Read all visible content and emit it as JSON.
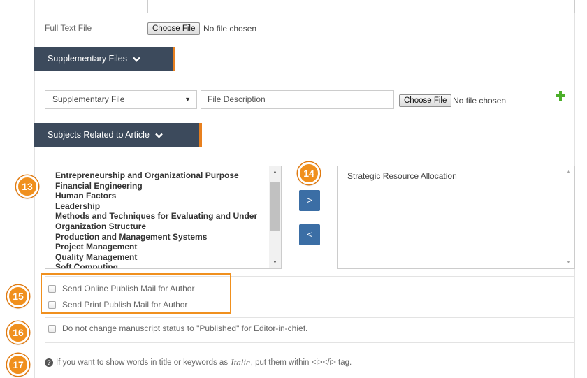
{
  "full_text": {
    "label": "Full Text File",
    "choose_label": "Choose File",
    "status": "No file chosen"
  },
  "supplementary": {
    "header": "Supplementary Files",
    "select_value": "Supplementary File",
    "description_placeholder": "File Description",
    "choose_label": "Choose File",
    "status": "No file chosen",
    "add_icon": "plus-icon"
  },
  "subjects": {
    "header": "Subjects Related to Article",
    "available": [
      "Entrepreneurship and Organizational Purpose",
      "Financial Engineering",
      "Human Factors",
      "Leadership",
      "Methods and Techniques for Evaluating and Under",
      "Organization Structure",
      "Production and Management Systems",
      "Project Management",
      "Quality Management",
      "Soft Computing"
    ],
    "selected": [
      "Strategic Resource Allocation"
    ],
    "move_right_label": ">",
    "move_left_label": "<"
  },
  "badges": {
    "b13": "13",
    "b14": "14",
    "b15": "15",
    "b16": "16",
    "b17": "17"
  },
  "publish_mail": {
    "online": "Send Online Publish Mail for Author",
    "print": "Send Print Publish Mail for Author"
  },
  "status_option": {
    "label": "Do not change manuscript status to \"Published\" for Editor-in-chief."
  },
  "info": {
    "icon": "?",
    "text_before": "If you want to show words in title or keywords as",
    "italic_word": "Italic",
    "text_after": ", put them within <i></i> tag."
  },
  "colors": {
    "header_bg": "#3c4a5c",
    "header_accent": "#e8801f",
    "badge": "#f0901e",
    "move_button": "#3b6ea5",
    "plus_icon": "#4caf2a"
  }
}
